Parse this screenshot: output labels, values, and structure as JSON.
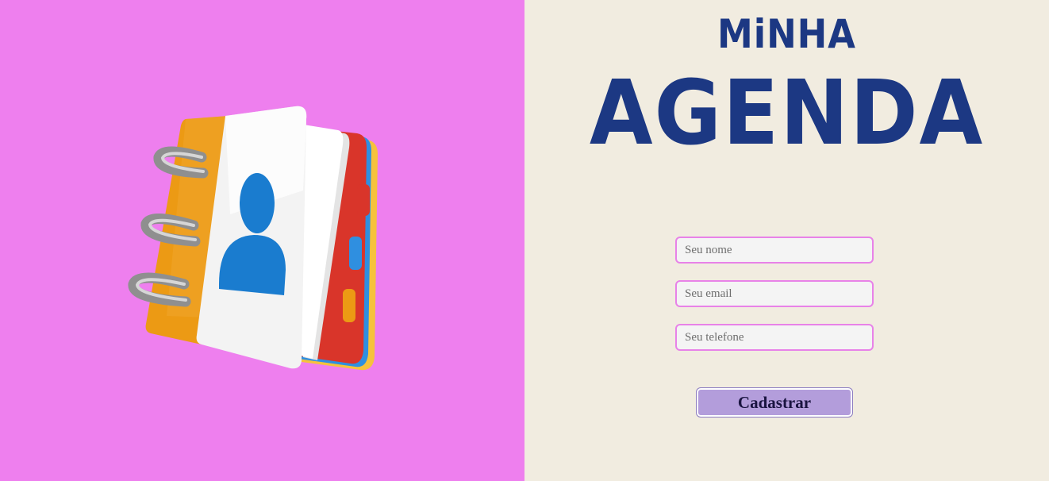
{
  "header": {
    "title_line1": "MiNHA",
    "title_line2": "AGENDA"
  },
  "illustration": {
    "icon": "contact-book-icon",
    "colors": {
      "background": "#ee7fee",
      "cover": "#ec9a14",
      "page": "#f2f2f2",
      "person": "#1a7ccf",
      "tab_red": "#d9352a",
      "ring": "#a8a8a8"
    }
  },
  "form": {
    "name_placeholder": "Seu nome",
    "email_placeholder": "Seu email",
    "phone_placeholder": "Seu telefone",
    "name_value": "",
    "email_value": "",
    "phone_value": "",
    "submit_label": "Cadastrar"
  },
  "colors": {
    "left_background": "#ee7fee",
    "right_background": "#f1ece0",
    "title": "#1c3883",
    "field_border": "#e882e8",
    "button_background": "#b39ddb"
  }
}
